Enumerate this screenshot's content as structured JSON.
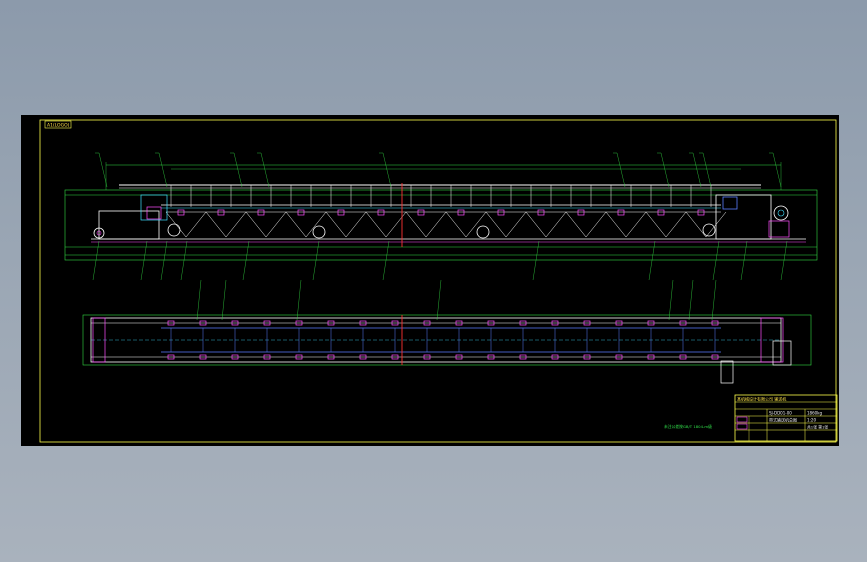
{
  "drawing": {
    "corner_tag": "A1(LOGO)",
    "note": "未注公差按GB/T 1804-m级",
    "title_block": {
      "company": "某机械设计有限公司 输送机",
      "drawing_no": "SJ-DD01-00",
      "name": "带式输送机总图",
      "scale": "1:20",
      "sheet": "共1张 第1张",
      "weight": "1860kg"
    },
    "colors": {
      "background": "#000000",
      "frame": "#ffff4d",
      "outline": "#ffffff",
      "dimension": "#33dd44",
      "part": "#ff4dff",
      "hidden": "#5a7cff",
      "centerline": "#ff3333",
      "highlight": "#40e0ff"
    }
  }
}
